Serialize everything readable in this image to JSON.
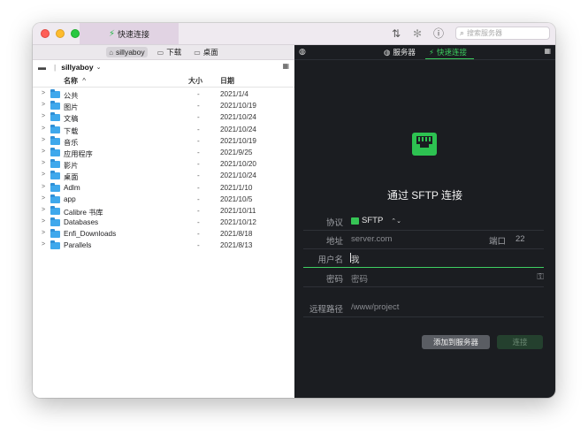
{
  "titlebar": {
    "tab_label": "快速连接",
    "search_placeholder": "搜索服务器"
  },
  "left": {
    "breadcrumbs": [
      "sillyaboy",
      "下载",
      "桌面"
    ],
    "location": "sillyaboy",
    "columns": {
      "name": "名称",
      "size": "大小",
      "date": "日期"
    },
    "rows": [
      {
        "name": "公共",
        "size": "-",
        "date": "2021/1/4"
      },
      {
        "name": "图片",
        "size": "-",
        "date": "2021/10/19"
      },
      {
        "name": "文稿",
        "size": "-",
        "date": "2021/10/24"
      },
      {
        "name": "下载",
        "size": "-",
        "date": "2021/10/24"
      },
      {
        "name": "音乐",
        "size": "-",
        "date": "2021/10/19"
      },
      {
        "name": "应用程序",
        "size": "-",
        "date": "2021/9/25"
      },
      {
        "name": "影片",
        "size": "-",
        "date": "2021/10/20"
      },
      {
        "name": "桌面",
        "size": "-",
        "date": "2021/10/24"
      },
      {
        "name": "Adlm",
        "size": "-",
        "date": "2021/1/10"
      },
      {
        "name": "app",
        "size": "-",
        "date": "2021/10/5"
      },
      {
        "name": "Calibre 书库",
        "size": "-",
        "date": "2021/10/11"
      },
      {
        "name": "Databases",
        "size": "-",
        "date": "2021/10/12"
      },
      {
        "name": "Enfi_Downloads",
        "size": "-",
        "date": "2021/8/18"
      },
      {
        "name": "Parallels",
        "size": "-",
        "date": "2021/8/13"
      }
    ]
  },
  "right": {
    "tabs": {
      "servers": "服务器",
      "quick": "快速连接"
    },
    "heading": "通过 SFTP 连接",
    "form": {
      "protocol_label": "协议",
      "protocol_value": "SFTP",
      "host_label": "地址",
      "host_placeholder": "server.com",
      "port_label": "端口",
      "port_value": "22",
      "user_label": "用户名",
      "user_value": "我",
      "password_label": "密码",
      "password_placeholder": "密码",
      "path_label": "远程路径",
      "path_placeholder": "/www/project"
    },
    "buttons": {
      "add": "添加到服务器",
      "connect": "连接"
    }
  },
  "colors": {
    "accent_green": "#3ccf5f",
    "folder_blue": "#3fa8ec",
    "dark_bg": "#1b1d21"
  }
}
